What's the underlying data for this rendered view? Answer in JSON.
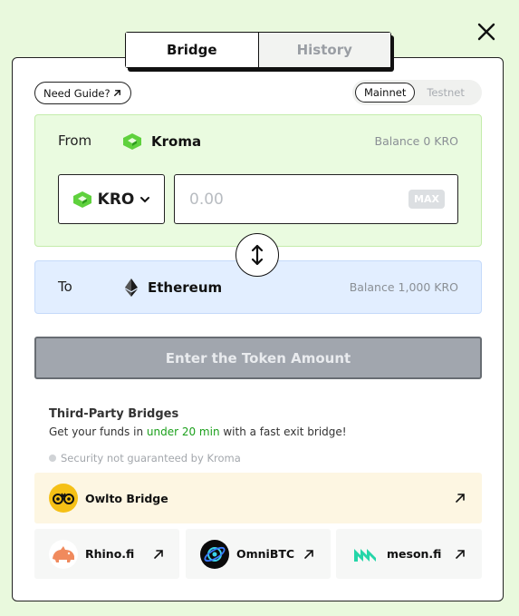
{
  "tabs": {
    "bridge": "Bridge",
    "history": "History"
  },
  "guide": {
    "label": "Need Guide?"
  },
  "network": {
    "mainnet": "Mainnet",
    "testnet": "Testnet",
    "selected": "Mainnet"
  },
  "from": {
    "label": "From",
    "chain": "Kroma",
    "balance": "Balance 0 KRO",
    "token": "KRO",
    "amount_placeholder": "0.00",
    "max_label": "MAX"
  },
  "to": {
    "label": "To",
    "chain": "Ethereum",
    "balance": "Balance 1,000 KRO"
  },
  "submit": {
    "label": "Enter the Token Amount"
  },
  "third_party": {
    "title": "Third-Party Bridges",
    "desc_pre": "Get your funds in ",
    "desc_highlight": "under 20 min",
    "desc_post": " with a fast exit bridge!",
    "note": "Security not guaranteed by Kroma",
    "bridges": [
      {
        "name": "Owlto Bridge"
      },
      {
        "name": "Rhino.fi"
      },
      {
        "name": "OmniBTC"
      },
      {
        "name": "meson.fi"
      }
    ]
  },
  "colors": {
    "accent_green": "#5fd13d",
    "highlight_green": "#1ca01c",
    "page_bg": "#e9f9dd"
  }
}
